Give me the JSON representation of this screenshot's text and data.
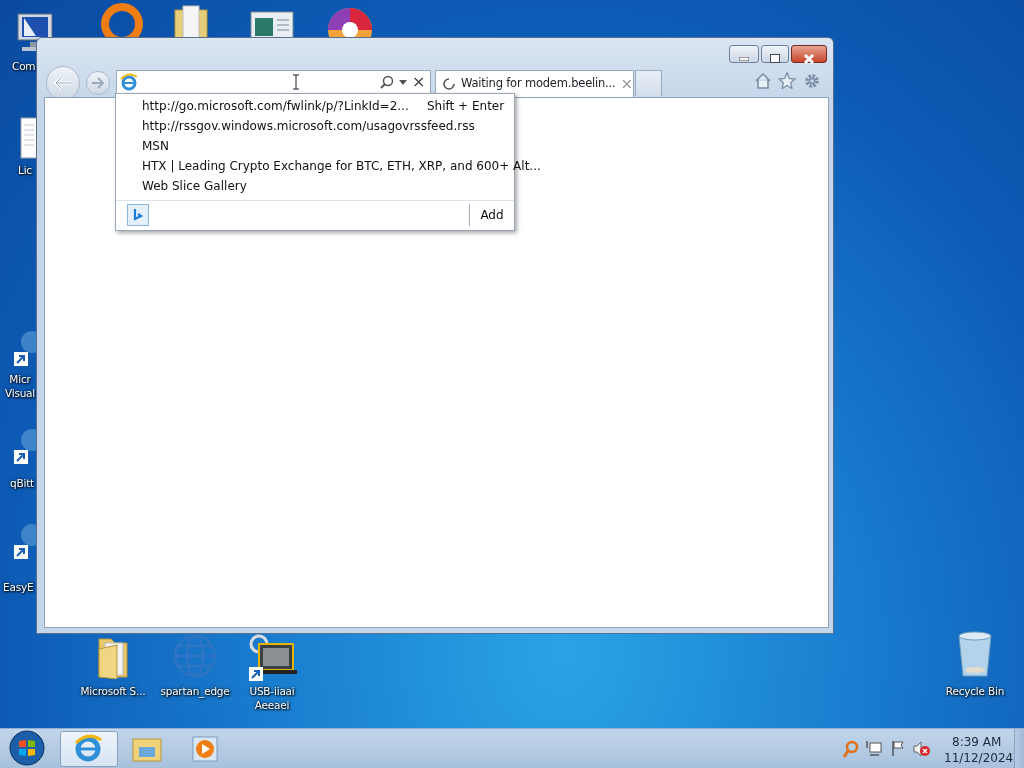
{
  "desktop": {
    "icons": [
      {
        "kind": "computer",
        "label": "Com"
      },
      {
        "kind": "document",
        "label": "Lic"
      },
      {
        "kind": "shortcut",
        "label": "Micr Visual"
      },
      {
        "kind": "shortcut",
        "label": "qBitt"
      },
      {
        "kind": "shortcut",
        "label": "EasyE"
      },
      {
        "kind": "folder",
        "label": "Microsoft S..."
      },
      {
        "kind": "globe",
        "label": "spartan_edge"
      },
      {
        "kind": "device",
        "label": "USB-iiaai Aeeaei"
      },
      {
        "kind": "recycle-bin",
        "label": "Recycle Bin"
      }
    ]
  },
  "browser": {
    "address_bar": {
      "clear": "×"
    },
    "tab": {
      "title": "Waiting for modem.beelin...",
      "loading": true,
      "close": "×"
    },
    "suggestions": [
      {
        "text": "http://go.microsoft.com/fwlink/p/?LinkId=2...",
        "hint": "Shift + Enter"
      },
      {
        "text": "http://rssgov.windows.microsoft.com/usagovrssfeed.rss"
      },
      {
        "text": "MSN"
      },
      {
        "text": "HTX | Leading Crypto Exchange for BTC, ETH, XRP, and 600+ Alt..."
      },
      {
        "text": "Web Slice Gallery"
      }
    ],
    "add_button": "Add"
  },
  "taskbar": {
    "items": [
      {
        "kind": "browser",
        "selected": true
      },
      {
        "kind": "explorer",
        "selected": false
      },
      {
        "kind": "media",
        "selected": false
      }
    ],
    "clock": {
      "time": "8:39 AM",
      "date": "11/12/2024"
    }
  }
}
